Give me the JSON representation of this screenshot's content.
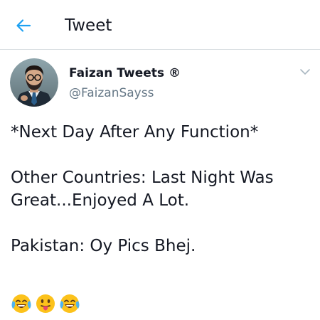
{
  "header": {
    "title": "Tweet",
    "back_icon": "arrow-left-icon",
    "accent_color": "#1da1f2"
  },
  "author": {
    "name": "Faizan Tweets ®",
    "handle": "@FaizanSayss",
    "avatar_icon": "profile-photo",
    "menu_icon": "chevron-down-icon"
  },
  "tweet": {
    "lines": [
      "*Next Day After Any Function*",
      "",
      "Other Countries: Last Night Was",
      "Great...Enjoyed A Lot.",
      "",
      "Pakistan: Oy Pics Bhej."
    ],
    "emojis": [
      "face-with-tears-of-joy",
      "face-with-tongue",
      "face-with-tears-of-joy"
    ]
  }
}
